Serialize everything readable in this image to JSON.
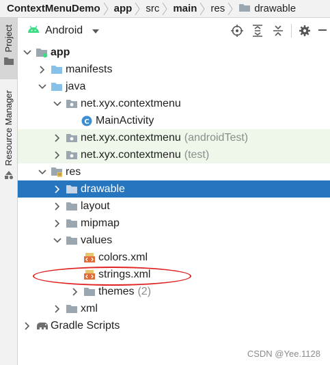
{
  "breadcrumb": [
    {
      "label": "ContextMenuDemo",
      "bold": true
    },
    {
      "label": "app",
      "bold": true
    },
    {
      "label": "src",
      "bold": false
    },
    {
      "label": "main",
      "bold": true
    },
    {
      "label": "res",
      "bold": false
    },
    {
      "label": "drawable",
      "bold": false
    }
  ],
  "tool_strip": {
    "project_label": "Project",
    "resource_manager_label": "Resource Manager"
  },
  "toolbar": {
    "view_label": "Android",
    "icons": [
      "locate-icon",
      "expand-all-icon",
      "collapse-all-icon",
      "settings-icon"
    ]
  },
  "tree": {
    "app": "app",
    "manifests": "manifests",
    "java": "java",
    "pkg_main": "net.xyx.contextmenu",
    "main_activity": "MainActivity",
    "pkg_android_test": "net.xyx.contextmenu",
    "android_test_hint": "(androidTest)",
    "pkg_test": "net.xyx.contextmenu",
    "test_hint": "(test)",
    "res": "res",
    "drawable": "drawable",
    "layout": "layout",
    "mipmap": "mipmap",
    "values": "values",
    "colors_xml": "colors.xml",
    "strings_xml": "strings.xml",
    "themes": "themes",
    "themes_count": "(2)",
    "xml": "xml",
    "gradle_scripts": "Gradle Scripts"
  },
  "colors": {
    "selection": "#2675bf",
    "test_highlight": "#eef7e9",
    "annotation": "#e02424",
    "folder_blue": "#87c1ea",
    "class_circle": "#3d8fd1"
  },
  "watermark": "CSDN @Yee.1128"
}
